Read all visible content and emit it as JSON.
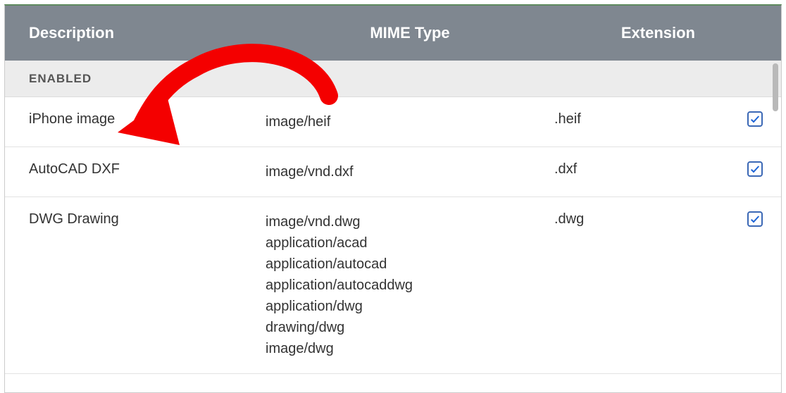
{
  "header": {
    "description": "Description",
    "mime": "MIME Type",
    "extension": "Extension"
  },
  "group_label": "ENABLED",
  "rows": [
    {
      "description": "iPhone image",
      "mimes": [
        "image/heif"
      ],
      "extension": ".heif",
      "checked": true
    },
    {
      "description": "AutoCAD DXF",
      "mimes": [
        "image/vnd.dxf"
      ],
      "extension": ".dxf",
      "checked": true
    },
    {
      "description": "DWG Drawing",
      "mimes": [
        "image/vnd.dwg",
        "application/acad",
        "application/autocad",
        "application/autocaddwg",
        "application/dwg",
        "drawing/dwg",
        "image/dwg"
      ],
      "extension": ".dwg",
      "checked": true
    }
  ]
}
